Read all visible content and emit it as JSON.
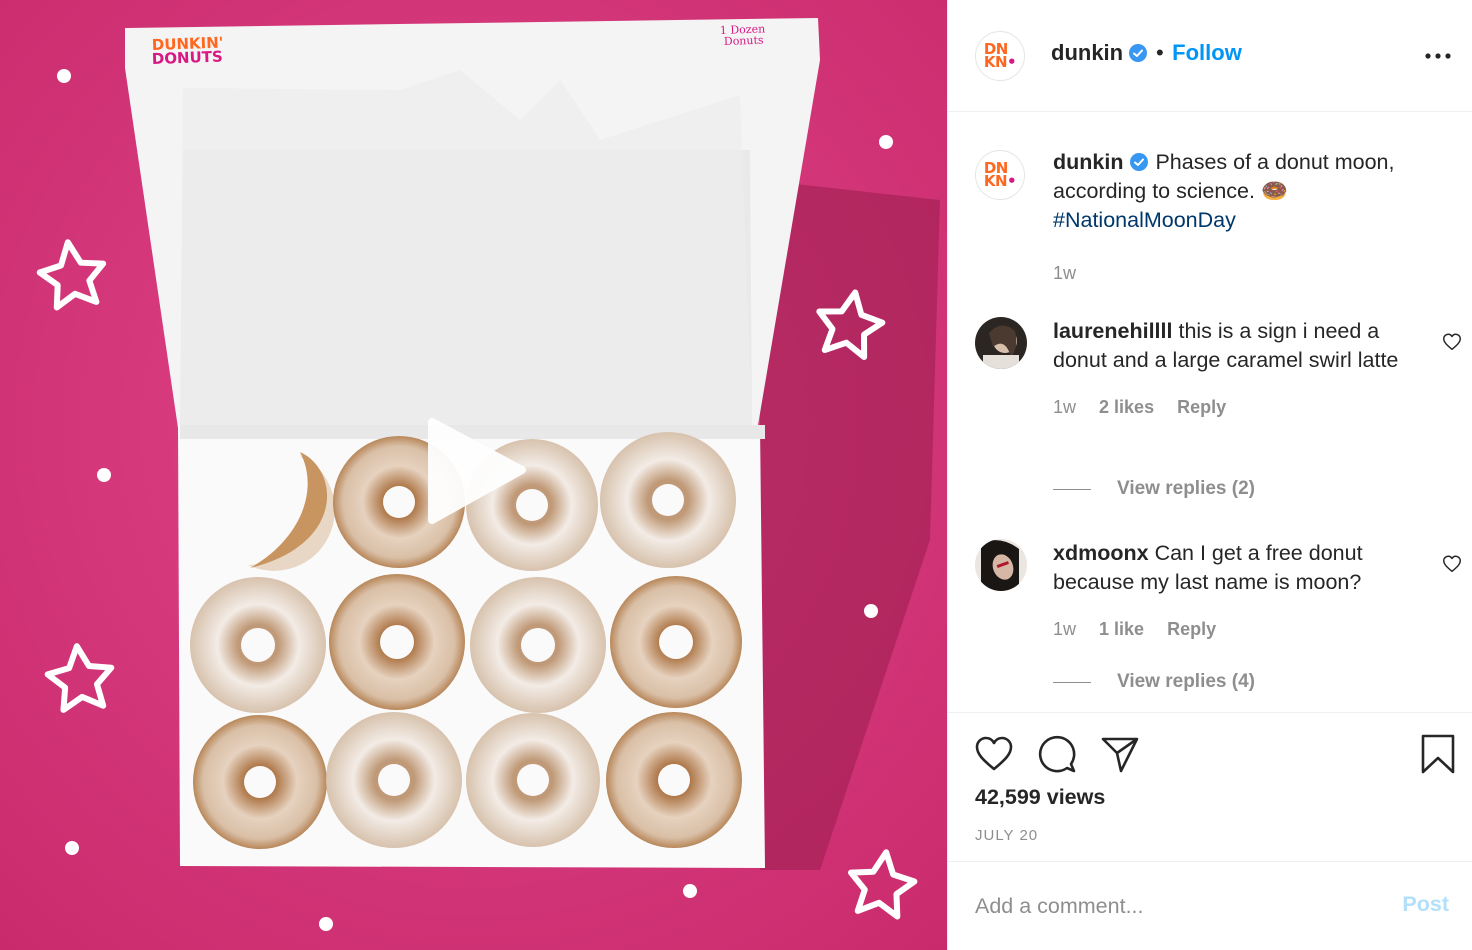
{
  "post": {
    "username": "dunkin",
    "follow_label": "Follow",
    "separator": "•",
    "more_icon": "more-horizontal-icon",
    "avatar_logo": {
      "line1": "DN",
      "line2": "KN",
      "brand_orange": "#ff671f",
      "brand_pink": "#da1884"
    }
  },
  "media": {
    "background_color": "#d63a7c",
    "box_brand": "DUNKIN' DONUTS",
    "box_label": "1 Dozen Donuts",
    "play_icon": "play-icon"
  },
  "caption": {
    "username": "dunkin",
    "text": "Phases of a donut moon, according to science. 🍩",
    "hashtag": "#NationalMoonDay",
    "time": "1w"
  },
  "comments": [
    {
      "username": "laurenehillll",
      "text": "this is a sign i need a donut and a large caramel swirl latte",
      "time": "1w",
      "likes": "2 likes",
      "reply_label": "Reply",
      "view_replies": "View replies (2)"
    },
    {
      "username": "xdmoonx",
      "text": "Can I get a free donut because my last name is moon?",
      "time": "1w",
      "likes": "1 like",
      "reply_label": "Reply",
      "view_replies": "View replies (4)"
    }
  ],
  "actions": {
    "like_icon": "heart-icon",
    "comment_icon": "comment-icon",
    "share_icon": "send-icon",
    "save_icon": "bookmark-icon",
    "views": "42,599 views",
    "date": "JULY 20"
  },
  "add_comment": {
    "placeholder": "Add a comment...",
    "post_label": "Post"
  },
  "colors": {
    "link_blue": "#0095f6",
    "hashtag_blue": "#00376b",
    "muted": "#8e8e8e",
    "post_disabled": "#b2dffc"
  }
}
